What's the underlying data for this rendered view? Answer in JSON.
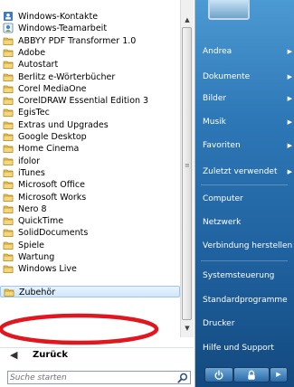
{
  "programs": [
    {
      "label": "Windows-Kontakte",
      "icon": "contacts-icon"
    },
    {
      "label": "Windows-Teamarbeit",
      "icon": "meeting-icon"
    },
    {
      "label": "ABBYY PDF Transformer 1.0",
      "icon": "folder-icon"
    },
    {
      "label": "Adobe",
      "icon": "folder-icon"
    },
    {
      "label": "Autostart",
      "icon": "folder-icon"
    },
    {
      "label": "Berlitz e-Wörterbücher",
      "icon": "folder-icon"
    },
    {
      "label": "Corel MediaOne",
      "icon": "folder-icon"
    },
    {
      "label": "CorelDRAW Essential Edition 3",
      "icon": "folder-icon"
    },
    {
      "label": "EgisTec",
      "icon": "folder-icon"
    },
    {
      "label": "Extras und Upgrades",
      "icon": "folder-icon"
    },
    {
      "label": "Google Desktop",
      "icon": "folder-icon"
    },
    {
      "label": "Home Cinema",
      "icon": "folder-icon"
    },
    {
      "label": "ifolor",
      "icon": "folder-icon"
    },
    {
      "label": "iTunes",
      "icon": "folder-icon"
    },
    {
      "label": "Microsoft Office",
      "icon": "folder-icon"
    },
    {
      "label": "Microsoft Works",
      "icon": "folder-icon"
    },
    {
      "label": "Nero 8",
      "icon": "folder-icon"
    },
    {
      "label": "QuickTime",
      "icon": "folder-icon"
    },
    {
      "label": "SolidDocuments",
      "icon": "folder-icon"
    },
    {
      "label": "Spiele",
      "icon": "folder-icon"
    },
    {
      "label": "Wartung",
      "icon": "folder-icon"
    },
    {
      "label": "Windows Live",
      "icon": "folder-icon"
    },
    {
      "label": "Zubehör",
      "icon": "folder-icon",
      "selected": true
    }
  ],
  "back": {
    "label": "Zurück"
  },
  "search": {
    "placeholder": "Suche starten"
  },
  "right_items": [
    {
      "label": "Andrea",
      "submenu": true
    },
    {
      "label": "Dokumente",
      "submenu": true
    },
    {
      "label": "Bilder",
      "submenu": true
    },
    {
      "label": "Musik",
      "submenu": true
    },
    {
      "label": "Favoriten",
      "submenu": true
    },
    {
      "label": "Zuletzt verwendet",
      "submenu": true
    },
    {
      "label": "Computer",
      "submenu": false
    },
    {
      "label": "Netzwerk",
      "submenu": false
    },
    {
      "label": "Verbindung herstellen",
      "submenu": false
    },
    {
      "label": "Systemsteuerung",
      "submenu": false
    },
    {
      "label": "Standardprogramme",
      "submenu": false
    },
    {
      "label": "Drucker",
      "submenu": false
    },
    {
      "label": "Hilfe und Support",
      "submenu": false
    }
  ],
  "colors": {
    "annotation": "#e0171e",
    "right_pane": "#2e78b7",
    "folder": "#e9c25a"
  }
}
